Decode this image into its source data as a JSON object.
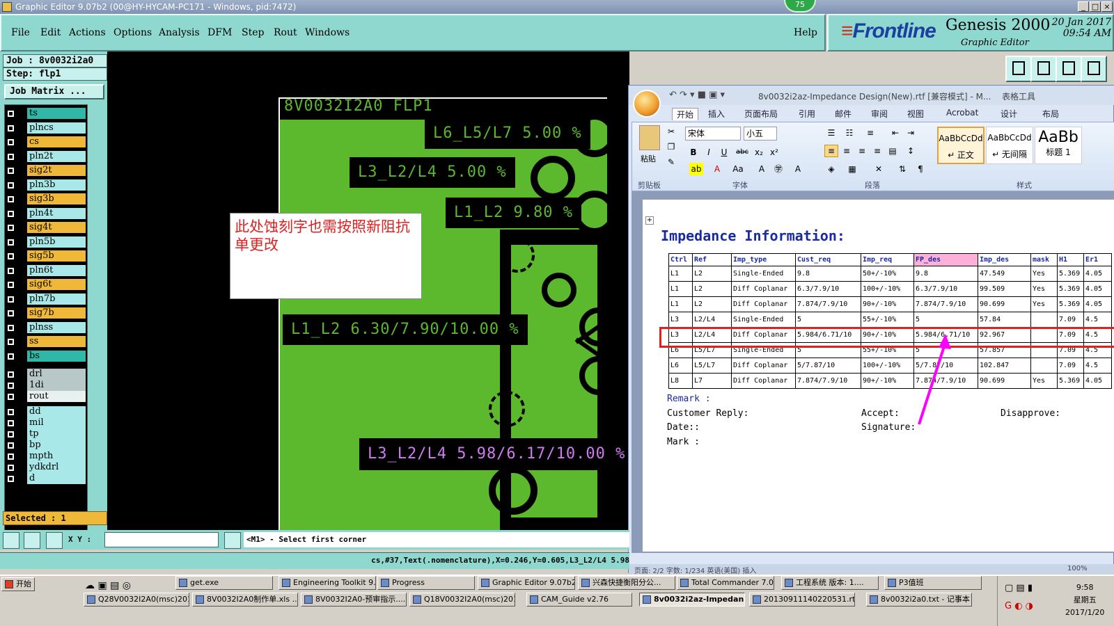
{
  "titlebar": {
    "title": "Graphic Editor 9.07b2 (00@HY-HYCAM-PC171 - Windows, pid:7472)",
    "badge": "75"
  },
  "menu": {
    "items": [
      "File",
      "Edit",
      "Actions",
      "Options",
      "Analysis",
      "DFM",
      "Step",
      "Rout",
      "Windows"
    ],
    "help": "Help"
  },
  "brand": {
    "logo": "Frontline",
    "product": "Genesis 2000",
    "subtitle": "Graphic Editor",
    "date": "20 Jan 2017",
    "time": "09:54 AM"
  },
  "left": {
    "job": "Job : 8v0032i2a0",
    "step": "Step: flp1",
    "job_matrix": "Job Matrix ...",
    "layers": [
      {
        "name": "ts",
        "color": "#2fb8a8"
      },
      {
        "name": "plncs",
        "color": "#a8e8e8"
      },
      {
        "name": "cs",
        "color": "#f0b838"
      },
      {
        "name": "pln2t",
        "color": "#a8e8e8"
      },
      {
        "name": "sig2t",
        "color": "#f0b838"
      },
      {
        "name": "pln3b",
        "color": "#a8e8e8"
      },
      {
        "name": "sig3b",
        "color": "#f0b838"
      },
      {
        "name": "pln4t",
        "color": "#a8e8e8"
      },
      {
        "name": "sig4t",
        "color": "#f0b838"
      },
      {
        "name": "pln5b",
        "color": "#a8e8e8"
      },
      {
        "name": "sig5b",
        "color": "#f0b838"
      },
      {
        "name": "pln6t",
        "color": "#a8e8e8"
      },
      {
        "name": "sig6t",
        "color": "#f0b838"
      },
      {
        "name": "pln7b",
        "color": "#a8e8e8"
      },
      {
        "name": "sig7b",
        "color": "#f0b838"
      },
      {
        "name": "plnss",
        "color": "#a8e8e8"
      },
      {
        "name": "ss",
        "color": "#f0b838"
      },
      {
        "name": "bs",
        "color": "#2fb8a8"
      },
      {
        "name": "drl",
        "color": "#b8c8c8"
      },
      {
        "name": "1di",
        "color": "#b8c8c8"
      },
      {
        "name": "rout",
        "color": "#e8f0f0"
      },
      {
        "name": "dd",
        "color": "#a8e8e8"
      },
      {
        "name": "mil",
        "color": "#a8e8e8"
      },
      {
        "name": "tp",
        "color": "#a8e8e8"
      },
      {
        "name": "bp",
        "color": "#a8e8e8"
      },
      {
        "name": "mpth",
        "color": "#a8e8e8"
      },
      {
        "name": "ydkdrl",
        "color": "#a8e8e8"
      },
      {
        "name": "d",
        "color": "#a8e8e8"
      }
    ],
    "selected": "Selected : 1"
  },
  "board": {
    "title": "8V0032I2A0 FLP1",
    "texts": [
      "L6_L5/L7 5.00 %",
      "L3_L2/L4 5.00 %",
      "L1_L2 9.80 %",
      "L1_L2 6.30/7.90/10.00 %"
    ],
    "selected_text": "L3_L2/L4 5.98/6.17/10.00 %",
    "note": "此处蚀刻字也需按照新阻抗单更改"
  },
  "command": {
    "xy_label": "X Y :",
    "xy_value": "",
    "message": "<M1> - Select first corner"
  },
  "infoline": "cs,#37,Text(.nomenclature),X=0.246,Y=0.605,L3_L2/L4 5.98",
  "word": {
    "title": "8v0032i2az-Impedance Design(New).rtf [兼容模式] - M...",
    "table_tools": "表格工具",
    "tabs": [
      "开始",
      "插入",
      "页面布局",
      "引用",
      "邮件",
      "审阅",
      "视图",
      "Acrobat",
      "设计",
      "布局"
    ],
    "groups": [
      "剪贴板",
      "字体",
      "段落",
      "样式"
    ],
    "font": "宋体",
    "size": "小五",
    "paste": "粘贴",
    "styles": [
      {
        "sample": "AaBbCcDd",
        "name": "↵ 正文"
      },
      {
        "sample": "AaBbCcDd",
        "name": "↵ 无间隔"
      },
      {
        "sample": "AaBb",
        "name": "标题 1"
      }
    ],
    "heading": "Impedance Information:",
    "headers": [
      "Ctrl",
      "Ref",
      "Imp_type",
      "Cust_req",
      "Imp_req",
      "FP_des",
      "Imp_des",
      "mask",
      "H1",
      "Er1"
    ],
    "rows": [
      [
        "L1",
        "L2",
        "Single-Ended",
        "9.8",
        "50+/-10%",
        "9.8",
        "47.549",
        "Yes",
        "5.369",
        "4.05"
      ],
      [
        "L1",
        "L2",
        "Diff Coplanar",
        "6.3/7.9/10",
        "100+/-10%",
        "6.3/7.9/10",
        "99.509",
        "Yes",
        "5.369",
        "4.05"
      ],
      [
        "L1",
        "L2",
        "Diff Coplanar",
        "7.874/7.9/10",
        "90+/-10%",
        "7.874/7.9/10",
        "90.699",
        "Yes",
        "5.369",
        "4.05"
      ],
      [
        "L3",
        "L2/L4",
        "Single-Ended",
        "5",
        "55+/-10%",
        "5",
        "57.84",
        "",
        "7.09",
        "4.5"
      ],
      [
        "L3",
        "L2/L4",
        "Diff Coplanar",
        "5.984/6.71/10",
        "90+/-10%",
        "5.984/6.71/10",
        "92.967",
        "",
        "7.09",
        "4.5"
      ],
      [
        "L6",
        "L5/L7",
        "Single-Ended",
        "5",
        "55+/-10%",
        "5",
        "57.857",
        "",
        "7.09",
        "4.5"
      ],
      [
        "L6",
        "L5/L7",
        "Diff Coplanar",
        "5/7.87/10",
        "100+/-10%",
        "5/7.87/10",
        "102.847",
        "",
        "7.09",
        "4.5"
      ],
      [
        "L8",
        "L7",
        "Diff Coplanar",
        "7.874/7.9/10",
        "90+/-10%",
        "7.874/7.9/10",
        "90.699",
        "Yes",
        "5.369",
        "4.05"
      ]
    ],
    "remark": "Remark :",
    "reply": "Customer Reply:",
    "accept": "Accept:",
    "disapprove": "Disapprove:",
    "date": "Date::",
    "signature": "Signature:",
    "mark": "Mark :",
    "status": "页面: 2/2    字数: 1/234    英语(美国)    插入",
    "zoom": "100%"
  },
  "taskbar": {
    "start": "开始",
    "row1": [
      "get.exe",
      "Engineering Toolkit 9....",
      "Progress",
      "Graphic Editor 9.07b2...",
      "兴森快捷衡阳分公...",
      "Total Commander 7.0...",
      "工程系统 版本: 1....",
      "P3值班"
    ],
    "row2": [
      "Q28V0032I2A0(msc)201...",
      "8V0032I2A0制作单.xls ...",
      "8V0032I2A0-预审指示....",
      "Q18V0032I2A0(msc)201...",
      "CAM_Guide v2.76",
      "8v0032i2az-Impedan...",
      "20130911140220531.rtf...",
      "8v0032i2a0.txt - 记事本"
    ],
    "time": "9:58",
    "weekday": "星期五",
    "date": "2017/1/20"
  }
}
